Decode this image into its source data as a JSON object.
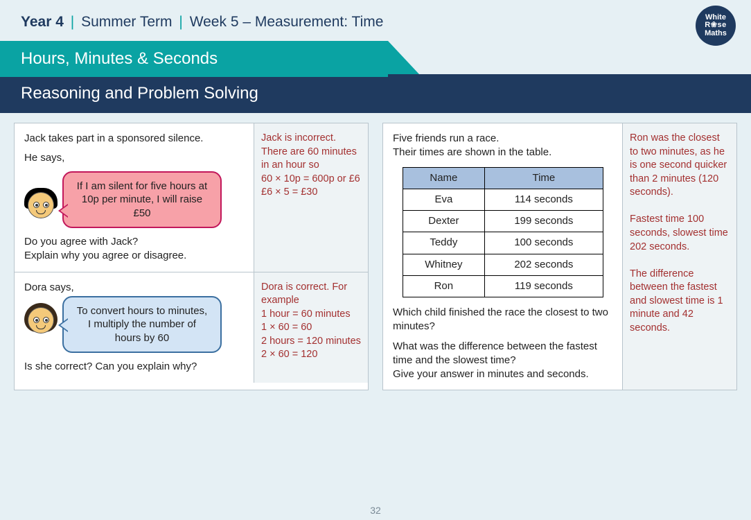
{
  "breadcrumb": {
    "year": "Year 4",
    "sep": "|",
    "term": "Summer Term",
    "week": "Week 5 – Measurement: Time"
  },
  "logo": {
    "l1": "White",
    "l2": "R❀se",
    "l3": "Maths"
  },
  "title_teal": "Hours, Minutes & Seconds",
  "title_navy": "Reasoning and Problem Solving",
  "page_number": "32",
  "q1": {
    "intro": "Jack takes part in a sponsored silence.",
    "says": "He says,",
    "speech": "If I am silent for five hours at 10p per minute, I will raise £50",
    "prompt1": "Do you agree with Jack?",
    "prompt2": "Explain why you agree or disagree.",
    "answer": "Jack is incorrect. There are 60 minutes in an hour so\n60 × 10p = 600p or £6\n£6 × 5 = £30"
  },
  "q2": {
    "says": "Dora says,",
    "speech": "To convert hours to minutes, I multiply the number of hours by 60",
    "prompt": "Is she correct? Can you explain why?",
    "answer": "Dora is correct. For example\n1 hour = 60 minutes\n1 × 60 = 60\n2 hours = 120 minutes\n2 × 60 = 120"
  },
  "q3": {
    "intro": "Five friends run a race.",
    "intro2": "Their times are shown in the table.",
    "table": {
      "headers": [
        "Name",
        "Time"
      ],
      "rows": [
        {
          "name": "Eva",
          "time": "114 seconds"
        },
        {
          "name": "Dexter",
          "time": "199 seconds"
        },
        {
          "name": "Teddy",
          "time": "100 seconds"
        },
        {
          "name": "Whitney",
          "time": "202 seconds"
        },
        {
          "name": "Ron",
          "time": "119 seconds"
        }
      ]
    },
    "prompt1": "Which child finished the race the closest to two minutes?",
    "prompt2": "What was the difference between the fastest time and the slowest time?",
    "prompt3": "Give your answer in minutes and seconds.",
    "answer": "Ron was the closest to two minutes, as he is one second quicker than 2 minutes (120 seconds).\n\nFastest time 100 seconds, slowest time 202 seconds.\n\nThe difference between the fastest and slowest time is 1 minute and 42 seconds."
  }
}
